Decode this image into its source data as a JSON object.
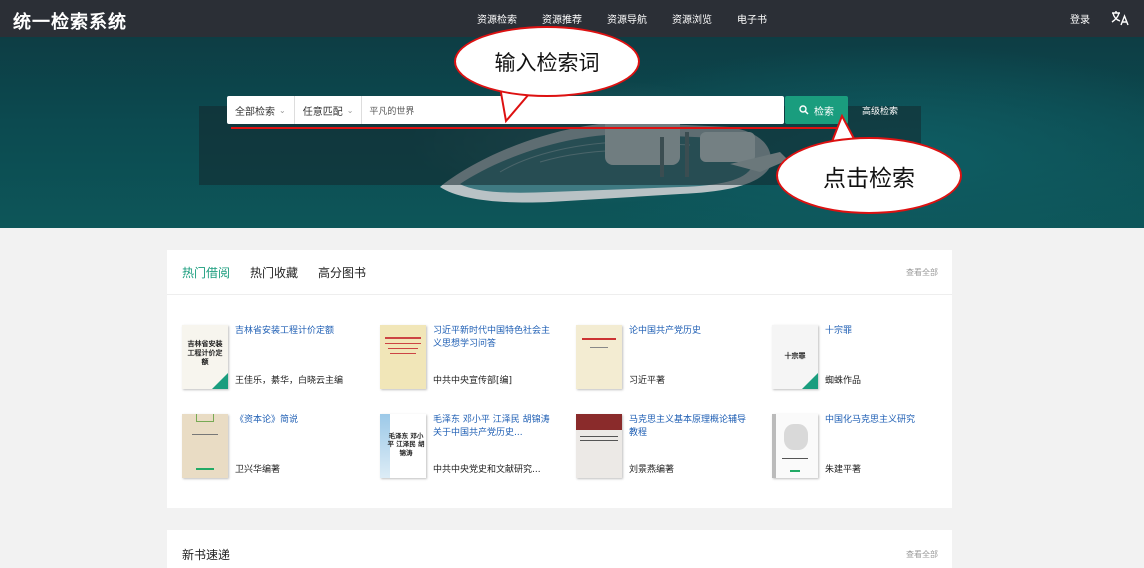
{
  "header": {
    "brand": "统一检索系统",
    "nav": [
      "资源检索",
      "资源推荐",
      "资源导航",
      "资源浏览",
      "电子书"
    ],
    "login": "登录",
    "lang_icon": "translate-icon"
  },
  "search": {
    "scope": "全部检索",
    "match": "任意匹配",
    "value": "平凡的世界",
    "button": "检索",
    "advanced": "高级检索"
  },
  "annotations": {
    "input_hint": "输入检索词",
    "click_hint": "点击检索"
  },
  "hot": {
    "tabs": [
      "热门借阅",
      "热门收藏",
      "高分图书"
    ],
    "active_tab": 0,
    "view_all": "查看全部",
    "books": [
      {
        "title": "吉林省安装工程计价定额",
        "author": "王佳乐，綦华，白晓云主编",
        "cover_text": "吉林省安装工程计价定额",
        "badge": true
      },
      {
        "title": "习近平新时代中国特色社会主义思想学习问答",
        "author": "中共中央宣传部[编]",
        "cover_text": "",
        "badge": false
      },
      {
        "title": "论中国共产党历史",
        "author": "习近平著",
        "cover_text": "",
        "badge": false
      },
      {
        "title": "十宗罪",
        "author": "蜘蛛作品",
        "cover_text": "十宗罪",
        "badge": true
      },
      {
        "title": "《资本论》简说",
        "author": "卫兴华编著",
        "cover_text": "",
        "badge": false
      },
      {
        "title": "毛泽东 邓小平 江泽民 胡锦涛 关于中国共产党历史...",
        "author": "中共中央党史和文献研究...",
        "cover_text": "毛泽东 邓小平 江泽民 胡锦涛",
        "badge": false
      },
      {
        "title": "马克思主义基本原理概论辅导教程",
        "author": "刘景燕编著",
        "cover_text": "",
        "badge": false
      },
      {
        "title": "中国化马克思主义研究",
        "author": "朱建平著",
        "cover_text": "",
        "badge": false
      }
    ]
  },
  "new_books": {
    "title": "新书速递",
    "view_all": "查看全部"
  }
}
